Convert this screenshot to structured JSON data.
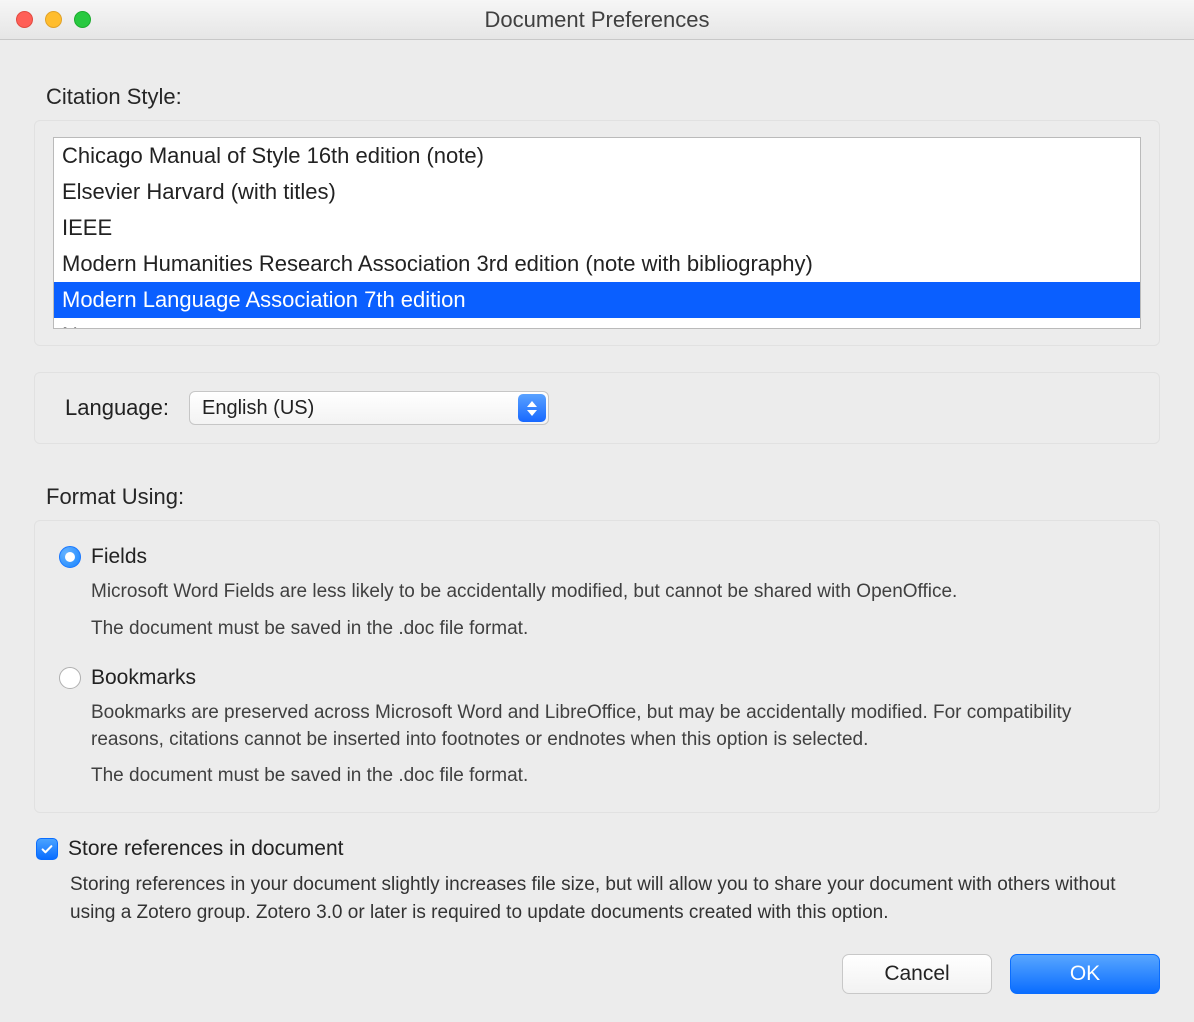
{
  "window": {
    "title": "Document Preferences"
  },
  "citation": {
    "label": "Citation Style:",
    "items": [
      "Chicago Manual of Style 16th edition (note)",
      "Elsevier Harvard (with titles)",
      "IEEE",
      "Modern Humanities Research Association 3rd edition (note with bibliography)",
      "Modern Language Association 7th edition",
      "Nature"
    ],
    "selected_index": 4
  },
  "language": {
    "label": "Language:",
    "value": "English (US)"
  },
  "format": {
    "label": "Format Using:",
    "options": [
      {
        "id": "fields",
        "title": "Fields",
        "desc1": "Microsoft Word Fields are less likely to be accidentally modified, but cannot be shared with OpenOffice.",
        "desc2": "The document must be saved in the .doc file format.",
        "checked": true
      },
      {
        "id": "bookmarks",
        "title": "Bookmarks",
        "desc1": "Bookmarks are preserved across Microsoft Word and LibreOffice, but may be accidentally modified. For compatibility reasons, citations cannot be inserted into footnotes or endnotes when this option is selected.",
        "desc2": "The document must be saved in the .doc file format.",
        "checked": false
      }
    ]
  },
  "store": {
    "checked": true,
    "title": "Store references in document",
    "desc": "Storing references in your document slightly increases file size, but will allow you to share your document with others without using a Zotero group. Zotero 3.0 or later is required to update documents created with this option."
  },
  "buttons": {
    "cancel": "Cancel",
    "ok": "OK"
  }
}
